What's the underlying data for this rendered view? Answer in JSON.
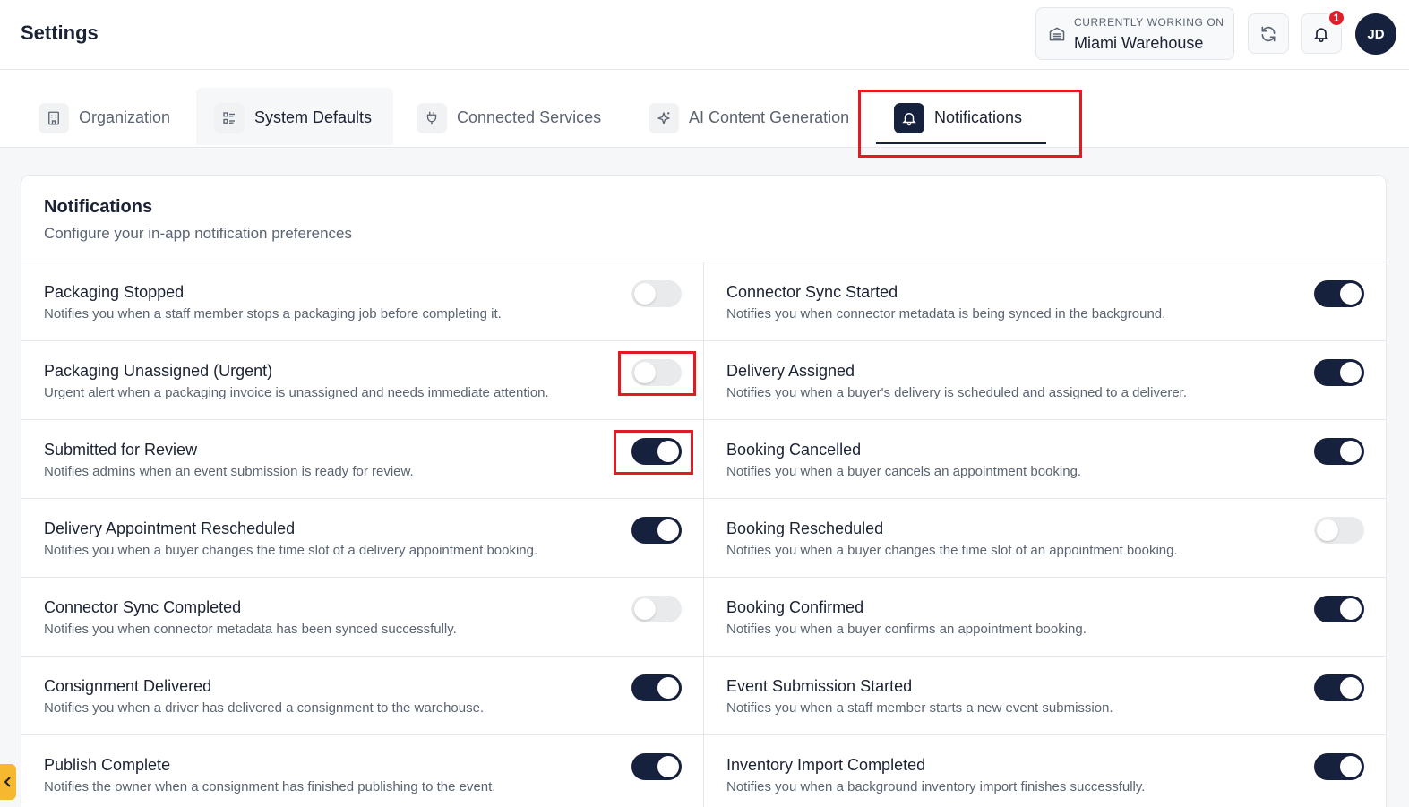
{
  "header": {
    "title": "Settings",
    "workspace_label": "CURRENTLY WORKING ON",
    "workspace_value": "Miami Warehouse",
    "notification_count": "1",
    "avatar_initials": "JD"
  },
  "tabs": [
    {
      "label": "Organization",
      "icon": "building-icon"
    },
    {
      "label": "System Defaults",
      "icon": "list-settings-icon"
    },
    {
      "label": "Connected Services",
      "icon": "plug-icon"
    },
    {
      "label": "AI Content Generation",
      "icon": "sparkles-icon"
    },
    {
      "label": "Notifications",
      "icon": "bell-icon",
      "active": true
    }
  ],
  "card": {
    "title": "Notifications",
    "subtitle": "Configure your in-app notification preferences"
  },
  "notifications": {
    "left": [
      {
        "title": "Packaging Stopped",
        "description": "Notifies you when a staff member stops a packaging job before completing it.",
        "enabled": false
      },
      {
        "title": "Packaging Unassigned (Urgent)",
        "description": "Urgent alert when a packaging invoice is unassigned and needs immediate attention.",
        "enabled": false
      },
      {
        "title": "Submitted for Review",
        "description": "Notifies admins when an event submission is ready for review.",
        "enabled": true
      },
      {
        "title": "Delivery Appointment Rescheduled",
        "description": "Notifies you when a buyer changes the time slot of a delivery appointment booking.",
        "enabled": true
      },
      {
        "title": "Connector Sync Completed",
        "description": "Notifies you when connector metadata has been synced successfully.",
        "enabled": false
      },
      {
        "title": "Consignment Delivered",
        "description": "Notifies you when a driver has delivered a consignment to the warehouse.",
        "enabled": true
      },
      {
        "title": "Publish Complete",
        "description": "Notifies the owner when a consignment has finished publishing to the event.",
        "enabled": true
      }
    ],
    "right": [
      {
        "title": "Connector Sync Started",
        "description": "Notifies you when connector metadata is being synced in the background.",
        "enabled": true
      },
      {
        "title": "Delivery Assigned",
        "description": "Notifies you when a buyer's delivery is scheduled and assigned to a deliverer.",
        "enabled": true
      },
      {
        "title": "Booking Cancelled",
        "description": "Notifies you when a buyer cancels an appointment booking.",
        "enabled": true
      },
      {
        "title": "Booking Rescheduled",
        "description": "Notifies you when a buyer changes the time slot of an appointment booking.",
        "enabled": false
      },
      {
        "title": "Booking Confirmed",
        "description": "Notifies you when a buyer confirms an appointment booking.",
        "enabled": true
      },
      {
        "title": "Event Submission Started",
        "description": "Notifies you when a staff member starts a new event submission.",
        "enabled": true
      },
      {
        "title": "Inventory Import Completed",
        "description": "Notifies you when a background inventory import finishes successfully.",
        "enabled": true
      }
    ]
  },
  "colors": {
    "accent": "#16213d",
    "highlight": "#e01b24",
    "badge": "#e11d2a",
    "side_handle": "#f5b82e"
  }
}
